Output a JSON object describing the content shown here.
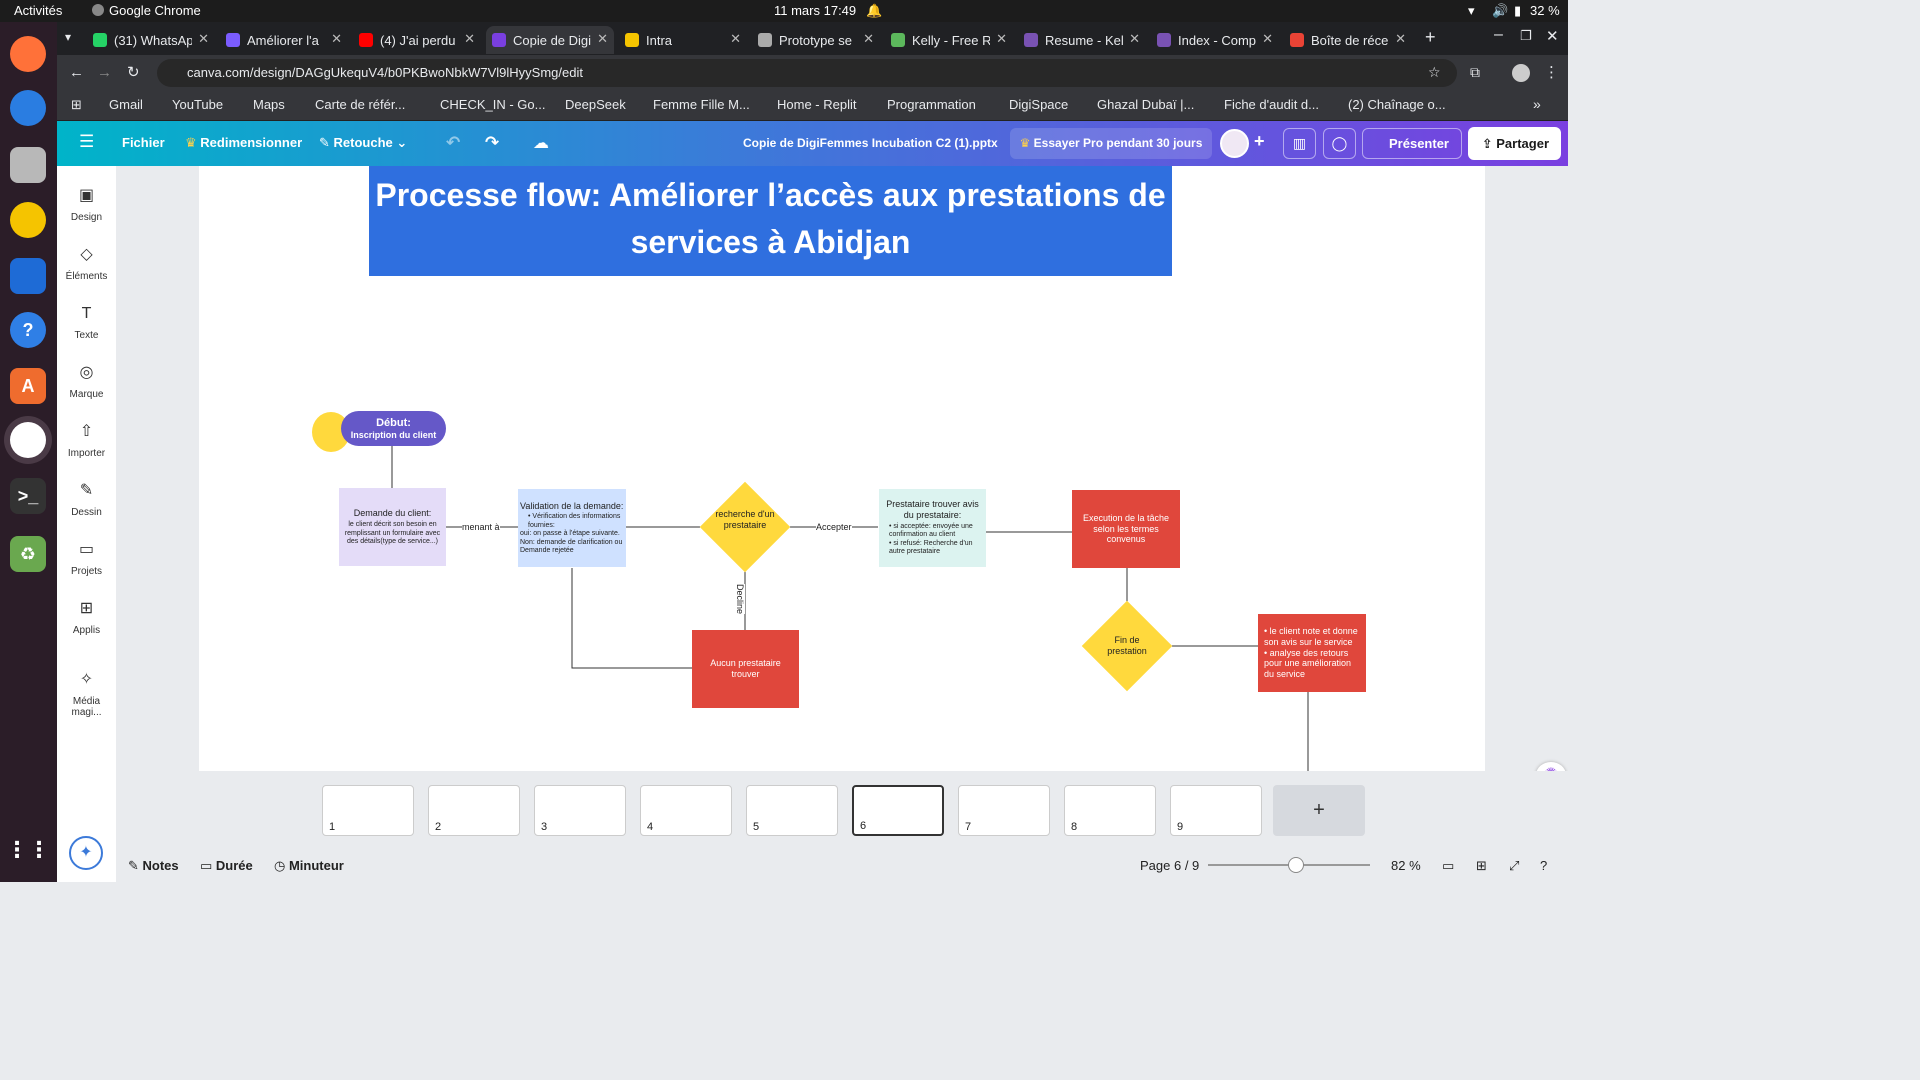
{
  "os": {
    "activities": "Activités",
    "app": "Google Chrome",
    "datetime": "11 mars  17:49",
    "battery": "32 %"
  },
  "colors": {
    "accent": "#7a3fe0",
    "title_bg": "#2f6fdf",
    "red_node": "#e0473c",
    "diamond": "#ffd93d",
    "purple_node": "#e4dcf8",
    "blue_node": "#cfe1ff",
    "teal_node": "#dcf3f0"
  },
  "tabs": [
    {
      "label": "(31) WhatsAp",
      "icon": "whatsapp-icon",
      "active": false
    },
    {
      "label": "Améliorer l'a",
      "icon": "doc-icon",
      "active": false
    },
    {
      "label": "(4) J'ai perdu",
      "icon": "youtube-icon",
      "active": false
    },
    {
      "label": "Copie de Digi",
      "icon": "canva-icon",
      "active": true
    },
    {
      "label": "Intra",
      "icon": "code-icon",
      "active": false
    },
    {
      "label": "Prototype se",
      "icon": "globe-icon",
      "active": false
    },
    {
      "label": "Kelly - Free R",
      "icon": "replit-icon",
      "active": false
    },
    {
      "label": "Resume - Kell",
      "icon": "bootstrap-icon",
      "active": false
    },
    {
      "label": "Index - Comp",
      "icon": "bootstrap-icon",
      "active": false
    },
    {
      "label": "Boîte de réce",
      "icon": "gmail-icon",
      "active": false
    }
  ],
  "address": {
    "url": "canva.com/design/DAGgUkequV4/b0PKBwoNbkW7Vl9lHyySmg/edit"
  },
  "bookmarks": [
    "Gmail",
    "YouTube",
    "Maps",
    "Carte de référ...",
    "CHECK_IN - Go...",
    "DeepSeek",
    "Femme Fille M...",
    "Home - Replit",
    "Programmation",
    "DigiSpace",
    "Ghazal Dubaï |...",
    "Fiche d'audit d...",
    "(2) Chaînage o..."
  ],
  "canva": {
    "file": "Fichier",
    "resize": "Redimensionner",
    "retouch": "Retouche",
    "doc_title": "Copie de DigiFemmes Incubation C2 (1).pptx",
    "pro": "Essayer Pro pendant 30 jours",
    "present": "Présenter",
    "share": "Partager"
  },
  "side": [
    "Design",
    "Éléments",
    "Texte",
    "Marque",
    "Importer",
    "Dessin",
    "Projets",
    "Applis",
    "Média magi..."
  ],
  "slide": {
    "title": "Processe flow: Améliorer l’accès aux prestations de services à Abidjan",
    "start_title": "Début:",
    "start_sub": "Inscription du client",
    "n1_title": "Demande du client:",
    "n1_body": "le client décrit son besoin en remplissant un formulaire avec des détails(type de service...)",
    "e1": "menant à",
    "n2_title": "Validation de la demande:",
    "n2_b1": "Vérification des informations fournies:",
    "n2_b2": "oui: on passe à l'étape suivante.",
    "n2_b3": "Non: demande de clarification ou Demande rejetée",
    "d1": "recherche d'un prestataire",
    "e2": "Accepter",
    "e3": "Decline",
    "n3_title": "Prestataire trouver avis du prestataire:",
    "n3_b1": "si acceptée: envoyée une confirmation au client",
    "n3_b2": "si refusé: Recherche d'un autre prestataire",
    "n4": "Execution de la tâche selon les termes convenus",
    "n5": "Aucun prestataire trouver",
    "d2": "Fin de prestation",
    "n6_b1": "le client note et donne son avis sur le service",
    "n6_b2": "analyse des retours pour une amélioration du service"
  },
  "thumbs": [
    "1",
    "2",
    "3",
    "4",
    "5",
    "6",
    "7",
    "8",
    "9"
  ],
  "bottom": {
    "notes": "Notes",
    "duration": "Durée",
    "timer": "Minuteur",
    "page": "Page 6 / 9",
    "zoom": "82 %",
    "zoom_level": 0.82
  }
}
